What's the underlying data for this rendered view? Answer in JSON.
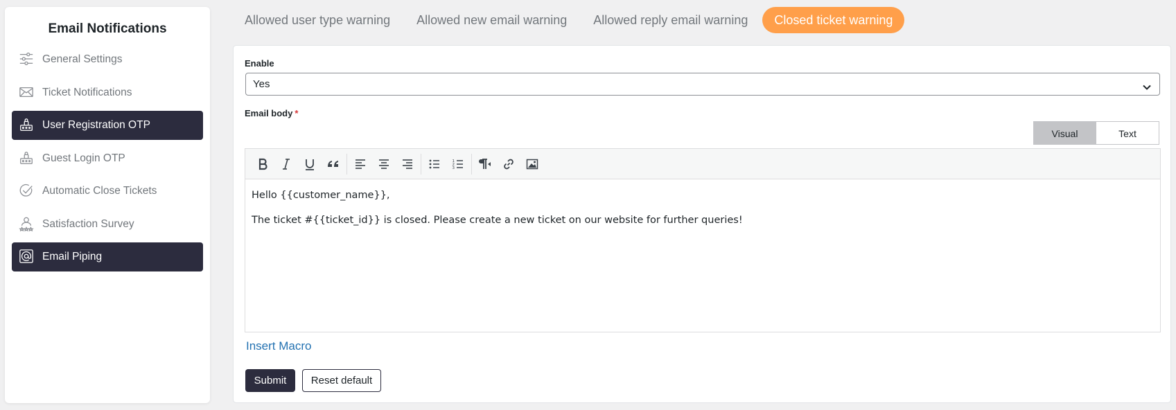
{
  "sidebar": {
    "title": "Email Notifications",
    "items": [
      {
        "label": "General Settings",
        "icon": "sliders-icon",
        "active": false
      },
      {
        "label": "Ticket Notifications",
        "icon": "envelope-icon",
        "active": false
      },
      {
        "label": "User Registration OTP",
        "icon": "otp-icon",
        "active": true
      },
      {
        "label": "Guest Login OTP",
        "icon": "otp-icon",
        "active": false
      },
      {
        "label": "Automatic Close Tickets",
        "icon": "check-circle-icon",
        "active": false
      },
      {
        "label": "Satisfaction Survey",
        "icon": "user-stars-icon",
        "active": false
      },
      {
        "label": "Email Piping",
        "icon": "at-sign-icon",
        "active": true
      }
    ]
  },
  "tabs": [
    {
      "label": "Allowed user type warning",
      "active": false
    },
    {
      "label": "Allowed new email warning",
      "active": false
    },
    {
      "label": "Allowed reply email warning",
      "active": false
    },
    {
      "label": "Closed ticket warning",
      "active": true
    }
  ],
  "form": {
    "enable_label": "Enable",
    "enable_value": "Yes",
    "email_body_label": "Email body",
    "required_mark": "*",
    "mode_visual": "Visual",
    "mode_text": "Text",
    "body_lines": [
      "Hello {{customer_name}},",
      "The ticket #{{ticket_id}} is closed. Please create a new ticket on our website for further queries!"
    ],
    "insert_macro": "Insert Macro",
    "submit_label": "Submit",
    "reset_label": "Reset default"
  },
  "toolbar_icons": [
    "bold-icon",
    "italic-icon",
    "underline-icon",
    "blockquote-icon",
    "align-left-icon",
    "align-center-icon",
    "align-right-icon",
    "bullet-list-icon",
    "numbered-list-icon",
    "paragraph-rtl-icon",
    "link-icon",
    "image-icon"
  ],
  "colors": {
    "accent": "#ff9f4a",
    "dark": "#2c2c3e",
    "link": "#2271b1",
    "required": "#d63638"
  }
}
